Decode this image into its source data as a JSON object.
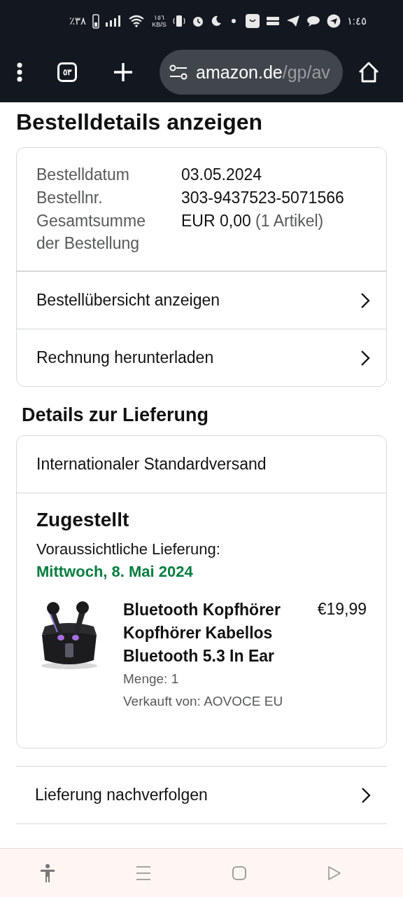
{
  "status_bar": {
    "battery": "٪٣٨",
    "speed_value": "١٥٦",
    "speed_unit": "KB/S",
    "time": "١:٤٥"
  },
  "browser": {
    "tab_count": "٥٣",
    "url_host": "amazon.de",
    "url_path": "/gp/av"
  },
  "page_title": "Bestelldetails anzeigen",
  "order_summary": {
    "fields": [
      {
        "label": "Bestelldatum",
        "value": "03.05.2024"
      },
      {
        "label": "Bestellnr.",
        "value": "303-9437523-5071566"
      },
      {
        "label": "Gesamtsumme der Bestellung",
        "value": "EUR 0,00",
        "note": "(1 Artikel)"
      }
    ],
    "links": [
      "Bestellübersicht anzeigen",
      "Rechnung herunterladen"
    ]
  },
  "delivery": {
    "heading": "Details zur Lieferung",
    "shipping_method": "Internationaler Standardversand",
    "status": "Zugestellt",
    "estimate_label": "Voraussichtliche Lieferung:",
    "estimate_date": "Mittwoch, 8. Mai 2024",
    "item": {
      "kind": "picture",
      "title": "Bluetooth Kopfhörer Kopfhörer Kabellos Bluetooth 5.3 In Ear",
      "price": "€19,99",
      "quantity": "Menge: 1",
      "seller": "Verkauft von: AOVOCE EU"
    }
  },
  "after_links": [
    "Lieferung nachverfolgen"
  ]
}
